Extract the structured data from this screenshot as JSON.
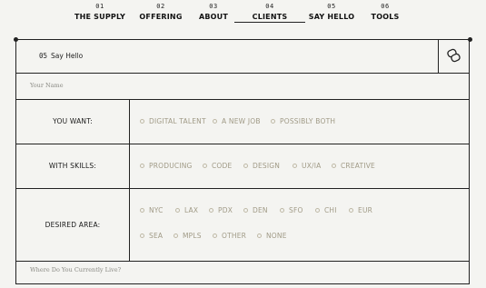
{
  "nav": {
    "items": [
      {
        "num": "01",
        "label": "THE SUPPLY"
      },
      {
        "num": "02",
        "label": "OFFERING"
      },
      {
        "num": "03",
        "label": "ABOUT"
      },
      {
        "num": "04",
        "label": "CLIENTS",
        "active": true
      },
      {
        "num": "05",
        "label": "SAY HELLO"
      },
      {
        "num": "06",
        "label": "TOOLS"
      }
    ]
  },
  "form": {
    "header": {
      "num": "05",
      "title": "Say Hello",
      "icon": "chat-bubbles-icon"
    },
    "name_placeholder": "Your Name",
    "want": {
      "label": "YOU WANT:",
      "options": [
        "DIGITAL TALENT",
        "A NEW JOB",
        "POSSIBLY BOTH"
      ]
    },
    "skills": {
      "label": "WITH SKILLS:",
      "options": [
        "PRODUCING",
        "CODE",
        "DESIGN",
        "UX/IA",
        "CREATIVE"
      ]
    },
    "area": {
      "label": "DESIRED AREA:",
      "options": [
        "NYC",
        "LAX",
        "PDX",
        "DEN",
        "SFO",
        "CHI",
        "EUR",
        "SEA",
        "MPLS",
        "OTHER",
        "NONE"
      ]
    },
    "location_placeholder": "Where Do You Currently Live?"
  },
  "colors": {
    "background": "#f4f4f1",
    "line": "#222222",
    "option_text": "#a09a86",
    "placeholder": "#8a8a84"
  }
}
